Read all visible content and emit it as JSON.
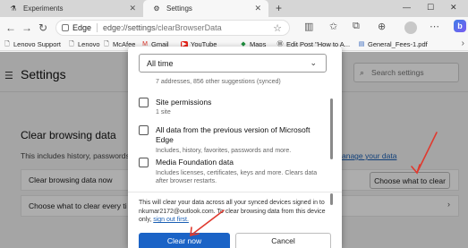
{
  "tabs": [
    {
      "label": "Experiments",
      "icon": "flask-icon"
    },
    {
      "label": "Settings",
      "icon": "gear-icon"
    }
  ],
  "address_bar": {
    "brand": "Edge",
    "url_host": "edge://settings",
    "url_path": "/clearBrowserData"
  },
  "favorites": [
    {
      "label": "Lenovo Support",
      "icon": "document-icon"
    },
    {
      "label": "Lenovo",
      "icon": "document-icon"
    },
    {
      "label": "McAfee",
      "icon": "document-icon"
    },
    {
      "label": "Gmail",
      "icon": "gmail-icon"
    },
    {
      "label": "YouTube",
      "icon": "youtube-icon"
    },
    {
      "label": "Maps",
      "icon": "maps-icon"
    },
    {
      "label": "Edit Post \"How to A...",
      "icon": "wordpress-icon"
    },
    {
      "label": "General_Fees-1.pdf",
      "icon": "pdf-icon"
    }
  ],
  "settings": {
    "title": "Settings",
    "search_placeholder": "Search settings",
    "section_title": "Clear browsing data",
    "section_desc": "This includes history, passwords,",
    "section_link": "anage your data",
    "row_1_label": "Clear browsing data now",
    "row_1_button": "Choose what to clear",
    "row_2_label": "Choose what to clear every ti"
  },
  "dialog": {
    "time_range": "All time",
    "passwords_hint": "7 addresses, 856 other suggestions (synced)",
    "options": [
      {
        "title": "Site permissions",
        "sub": "1 site"
      },
      {
        "title": "All data from the previous version of Microsoft Edge",
        "sub": "Includes, history, favorites, passwords and more."
      },
      {
        "title": "Media Foundation data",
        "sub": "Includes licenses, certificates, keys and more. Clears data after browser restarts."
      }
    ],
    "message_part_1": "This will clear your data across all your synced devices signed in to nkumar2172@outlook.com. To clear browsing data from this device only,",
    "signout_link": "sign out first.",
    "clear_button": "Clear now",
    "cancel_button": "Cancel"
  },
  "colors": {
    "accent": "#1b63c6",
    "annotation_arrow": "#e03a2f"
  }
}
